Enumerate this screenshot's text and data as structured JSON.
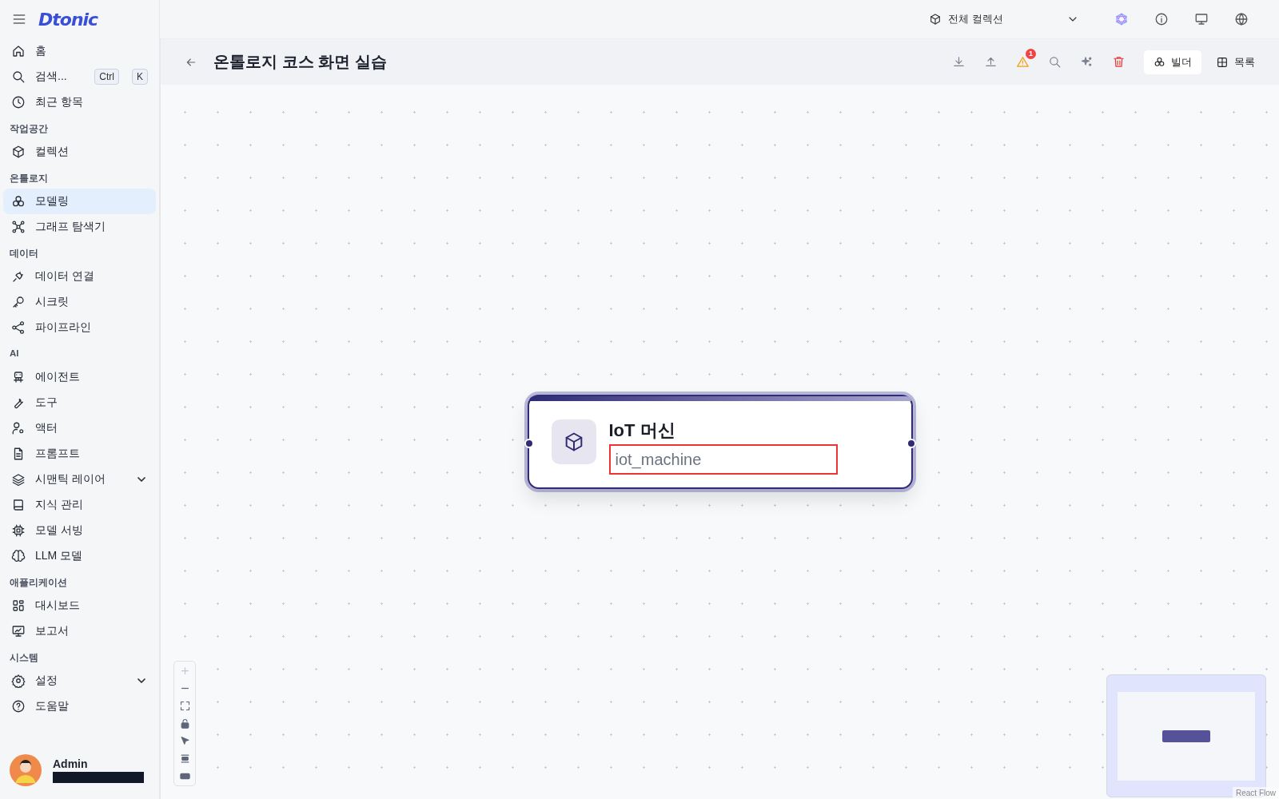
{
  "app": {
    "logo": "Dtonic"
  },
  "sidebar": {
    "sections": [
      {
        "items": [
          {
            "label": "홈",
            "kind": "link",
            "selected": false
          },
          {
            "label": "검색...",
            "kind": "search",
            "shortcut": [
              "Ctrl",
              "K"
            ],
            "selected": false
          },
          {
            "label": "최근 항목",
            "kind": "link",
            "selected": false
          }
        ]
      },
      {
        "label": "작업공간",
        "items": [
          {
            "label": "컬렉션",
            "kind": "link",
            "selected": false
          }
        ]
      },
      {
        "label": "온톨로지",
        "items": [
          {
            "label": "모델링",
            "kind": "link",
            "selected": true
          },
          {
            "label": "그래프 탐색기",
            "kind": "link",
            "selected": false
          }
        ]
      },
      {
        "label": "데이터",
        "items": [
          {
            "label": "데이터 연결",
            "kind": "link",
            "selected": false
          },
          {
            "label": "시크릿",
            "kind": "link",
            "selected": false
          },
          {
            "label": "파이프라인",
            "kind": "link",
            "selected": false
          }
        ]
      },
      {
        "label": "AI",
        "items": [
          {
            "label": "에이전트",
            "kind": "link",
            "selected": false
          },
          {
            "label": "도구",
            "kind": "link",
            "selected": false
          },
          {
            "label": "액터",
            "kind": "link",
            "selected": false
          },
          {
            "label": "프롬프트",
            "kind": "link",
            "selected": false
          },
          {
            "label": "시맨틱 레이어",
            "kind": "group",
            "expanded": false,
            "selected": false
          },
          {
            "label": "지식 관리",
            "kind": "link",
            "selected": false
          },
          {
            "label": "모델 서빙",
            "kind": "link",
            "selected": false
          },
          {
            "label": "LLM 모델",
            "kind": "link",
            "selected": false
          }
        ]
      },
      {
        "label": "애플리케이션",
        "items": [
          {
            "label": "대시보드",
            "kind": "link",
            "selected": false
          },
          {
            "label": "보고서",
            "kind": "link",
            "selected": false
          }
        ]
      },
      {
        "label": "시스템",
        "items": [
          {
            "label": "설정",
            "kind": "group",
            "expanded": false,
            "selected": false
          },
          {
            "label": "도움말",
            "kind": "link",
            "selected": false
          }
        ]
      }
    ],
    "user": {
      "name": "Admin"
    }
  },
  "topbar": {
    "collection": "전체 컬렉션"
  },
  "header": {
    "title": "온톨로지 코스 화면 실습",
    "warning_count": "1",
    "view_tabs": [
      {
        "label": "빌더",
        "selected": true
      },
      {
        "label": "목록",
        "selected": false
      }
    ]
  },
  "canvas": {
    "node": {
      "title": "IoT 머신",
      "name": "iot_machine",
      "highlighted": true
    },
    "attribution": "React Flow"
  }
}
